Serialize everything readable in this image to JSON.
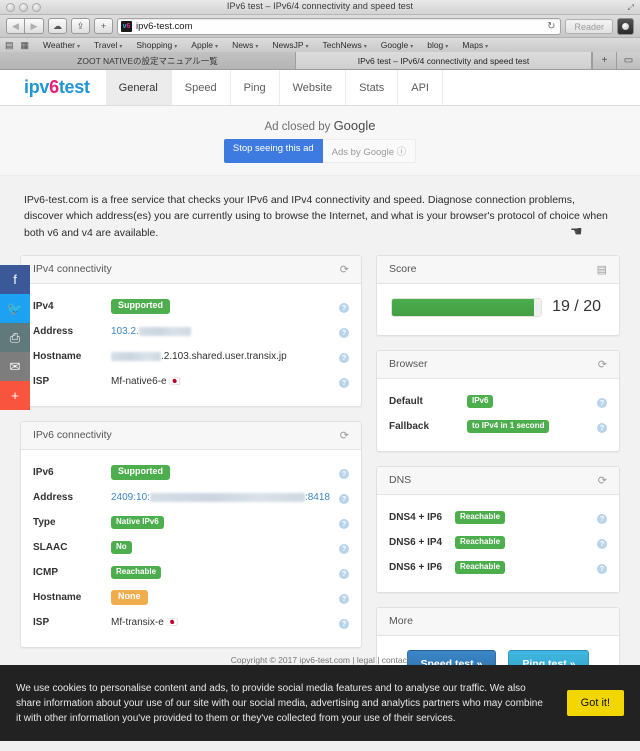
{
  "browser": {
    "window_title": "IPv6 test – IPv6/4 connectivity and speed test",
    "back_icon": "◀",
    "forward_icon": "▶",
    "cloud_icon": "☁",
    "share_icon": "⇪",
    "new_tab_icon": "+",
    "favicon_text": "v",
    "favicon_accent": "6",
    "url": "ipv6-test.com",
    "reload_icon": "↻",
    "reader_label": "Reader",
    "bookmarks_icon": "▤",
    "topsites_icon": "▦",
    "bookmarks": [
      {
        "label": "Weather"
      },
      {
        "label": "Travel"
      },
      {
        "label": "Shopping"
      },
      {
        "label": "Apple"
      },
      {
        "label": "News"
      },
      {
        "label": "NewsJP"
      },
      {
        "label": "TechNews"
      },
      {
        "label": "Google"
      },
      {
        "label": "blog"
      },
      {
        "label": "Maps"
      }
    ],
    "caret": "▾",
    "tabs": [
      {
        "label": "ZOOT NATIVEの設定マニュアル一覧",
        "active": false
      },
      {
        "label": "IPv6 test – IPv6/4 connectivity and speed test",
        "active": true
      }
    ],
    "tab_new_icon": "+",
    "tab_overview_icon": "▭"
  },
  "site": {
    "logo": {
      "pre": "ipv",
      "accent": "6",
      "post": " test"
    },
    "nav": [
      {
        "label": "General",
        "active": true
      },
      {
        "label": "Speed",
        "active": false
      },
      {
        "label": "Ping",
        "active": false
      },
      {
        "label": "Website",
        "active": false
      },
      {
        "label": "Stats",
        "active": false
      },
      {
        "label": "API",
        "active": false
      }
    ]
  },
  "ad": {
    "closed_text": "Ad closed by ",
    "brand": "Google",
    "stop_label": "Stop seeing this ad",
    "ads_by_label": "Ads by Google ⓘ",
    "cursor_glyph": "☚"
  },
  "intro": {
    "text": "IPv6-test.com is a free service that checks your IPv6 and IPv4 connectivity and speed. Diagnose connection problems, discover which address(es) you are currently using to browse the Internet, and what is your browser's protocol of choice when both v6 and v4 are available."
  },
  "social": [
    {
      "name": "facebook",
      "glyph": "f",
      "color": "#3b5998"
    },
    {
      "name": "twitter",
      "glyph": "🐦",
      "color": "#1da1f2"
    },
    {
      "name": "print",
      "glyph": "⎙",
      "color": "#62797c"
    },
    {
      "name": "email",
      "glyph": "✉",
      "color": "#7d7d7d"
    },
    {
      "name": "more",
      "glyph": "+",
      "color": "#f9543e"
    }
  ],
  "ipv4": {
    "title": "IPv4 connectivity",
    "refresh_icon": "⟳",
    "help_icon": "?",
    "rows": [
      {
        "label": "IPv4",
        "value": "Supported",
        "kind": "badge-green"
      },
      {
        "label": "Address",
        "value": "103.2.",
        "kind": "address-redacted",
        "blur_width": 52
      },
      {
        "label": "Hostname",
        "value": ".2.103.shared.user.transix.jp",
        "kind": "text-redacted-prefix",
        "blur_width": 50
      },
      {
        "label": "ISP",
        "value": "Mf-native6-e",
        "kind": "text-flag",
        "flag": "🇯🇵"
      }
    ]
  },
  "ipv6": {
    "title": "IPv6 connectivity",
    "refresh_icon": "⟳",
    "help_icon": "?",
    "rows": [
      {
        "label": "IPv6",
        "value": "Supported",
        "kind": "badge-green"
      },
      {
        "label": "Address",
        "value": "2409:10:",
        "suffix": ":8418",
        "kind": "address-redacted-mid",
        "blur_width": 155
      },
      {
        "label": "Type",
        "value": "Native IPv6",
        "kind": "badge-green-sm"
      },
      {
        "label": "SLAAC",
        "value": "No",
        "kind": "badge-green-sm"
      },
      {
        "label": "ICMP",
        "value": "Reachable",
        "kind": "badge-green-sm"
      },
      {
        "label": "Hostname",
        "value": "None",
        "kind": "badge-orange"
      },
      {
        "label": "ISP",
        "value": "Mf-transix-e",
        "kind": "text-flag",
        "flag": "🇯🇵"
      }
    ]
  },
  "score": {
    "title": "Score",
    "list_icon": "▤",
    "value": 19,
    "max": 20,
    "display": "19 / 20",
    "percent": 95,
    "bar_color": "#4cae4c"
  },
  "browser_panel": {
    "title": "Browser",
    "refresh_icon": "⟳",
    "help_icon": "?",
    "rows": [
      {
        "label": "Default",
        "value": "IPv6",
        "kind": "badge-green-sm"
      },
      {
        "label": "Fallback",
        "value": "to IPv4 in 1 second",
        "kind": "badge-green-sm"
      }
    ]
  },
  "dns": {
    "title": "DNS",
    "refresh_icon": "⟳",
    "help_icon": "?",
    "rows": [
      {
        "label": "DNS4 + IP6",
        "value": "Reachable",
        "kind": "badge-green-sm"
      },
      {
        "label": "DNS6 + IP4",
        "value": "Reachable",
        "kind": "badge-green-sm"
      },
      {
        "label": "DNS6 + IP6",
        "value": "Reachable",
        "kind": "badge-green-sm"
      }
    ]
  },
  "more": {
    "title": "More",
    "speed_label": "Speed test »",
    "ping_label": "Ping test »"
  },
  "footer": {
    "text": "Copyright © 2017 ipv6-test.com  |  legal  |  contact"
  },
  "cookie": {
    "text": "We use cookies to personalise content and ads, to provide social media features and to analyse our traffic. We also share information about your use of our site with our social media, advertising and analytics partners who may combine it with other information you've provided to them or they've collected from your use of their services.",
    "button_label": "Got it!",
    "button_color": "#f1d600"
  }
}
